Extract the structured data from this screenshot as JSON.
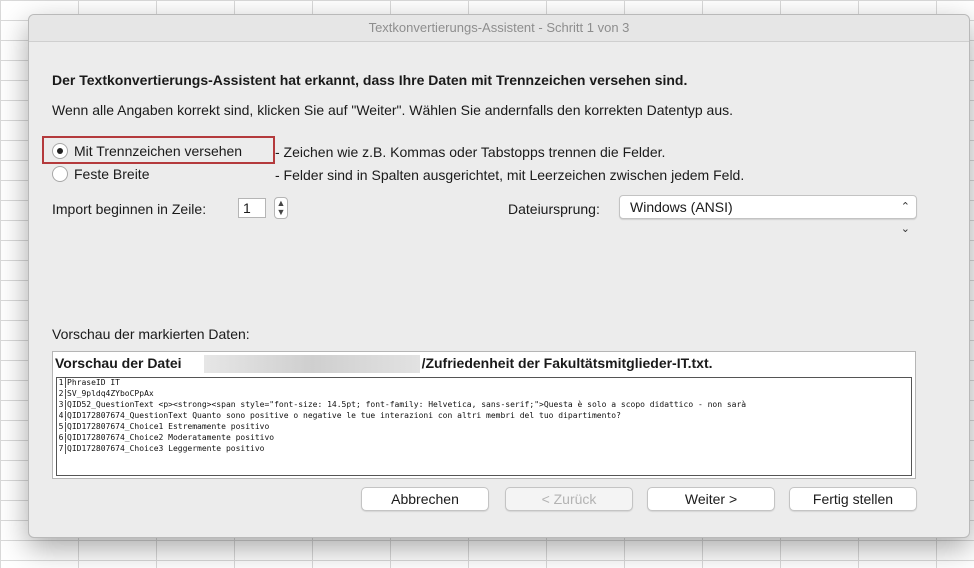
{
  "window": {
    "title": "Textkonvertierungs-Assistent - Schritt 1 von 3"
  },
  "heading": "Der Textkonvertierungs-Assistent hat erkannt, dass Ihre Daten mit Trennzeichen versehen sind.",
  "instruction": "Wenn alle Angaben korrekt sind, klicken Sie auf \"Weiter\". Wählen Sie andernfalls den korrekten Datentyp aus.",
  "data_type": {
    "options": [
      {
        "label": "Mit Trennzeichen versehen",
        "description": "- Zeichen wie z.B. Kommas oder Tabstopps trennen die Felder.",
        "selected": true
      },
      {
        "label": "Feste Breite",
        "description": "- Felder sind in Spalten ausgerichtet, mit Leerzeichen zwischen jedem Feld.",
        "selected": false
      }
    ]
  },
  "import_row": {
    "label": "Import beginnen in Zeile:",
    "value": "1"
  },
  "file_origin": {
    "label": "Dateiursprung:",
    "value": "Windows (ANSI)"
  },
  "preview": {
    "label": "Vorschau der markierten Daten:",
    "file_prefix": "Vorschau der Datei",
    "file_suffix": "/Zufriedenheit der Fakultätsmitglieder-IT.txt.",
    "lines": [
      {
        "num": "1",
        "text": "PhraseID IT"
      },
      {
        "num": "2",
        "text": "SV_9pldq4ZYboCPpAx"
      },
      {
        "num": "3",
        "text": "QID52_QuestionText <p><strong><span style=\"font-size: 14.5pt; font-family: Helvetica, sans-serif;\">Questa è  solo a scopo didattico - non sarà"
      },
      {
        "num": "4",
        "text": "QID172807674_QuestionText Quanto sono positive o negative le tue interazioni con altri membri del tuo dipartimento?"
      },
      {
        "num": "5",
        "text": "QID172807674_Choice1 Estremamente positivo"
      },
      {
        "num": "6",
        "text": "QID172807674_Choice2 Moderatamente positivo"
      },
      {
        "num": "7",
        "text": "QID172807674_Choice3 Leggermente positivo"
      }
    ]
  },
  "buttons": {
    "cancel": "Abbrechen",
    "back": "< Zurück",
    "next": "Weiter >",
    "finish": "Fertig stellen"
  }
}
